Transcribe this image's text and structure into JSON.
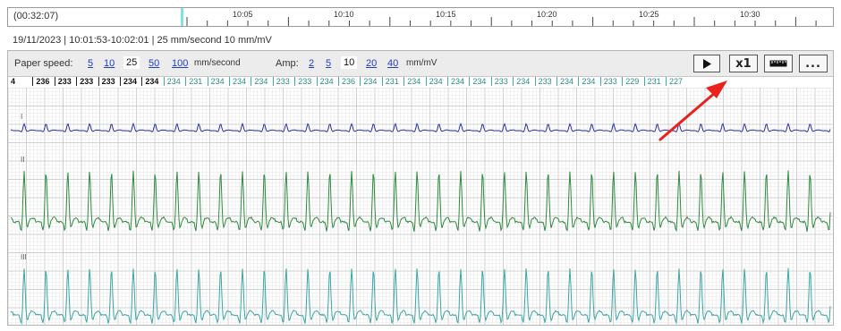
{
  "timeline": {
    "elapsed": "(00:32:07)",
    "labels": [
      "10:05",
      "10:10",
      "10:15",
      "10:20",
      "10:25",
      "10:30"
    ]
  },
  "session_info": "19/11/2023 | 10:01:53-10:02:01 | 25 mm/second 10 mm/mV",
  "toolbar": {
    "paper_speed_label": "Paper speed:",
    "paper_speed_options": [
      "5",
      "10",
      "25",
      "50",
      "100"
    ],
    "paper_speed_selected": "25",
    "paper_speed_unit": "mm/second",
    "amp_label": "Amp:",
    "amp_options": [
      "2",
      "5",
      "10",
      "20",
      "40"
    ],
    "amp_selected": "10",
    "amp_unit": "mm/mV",
    "speed_button_label": "x1",
    "more_button_label": "...",
    "play_icon": "play-icon",
    "ruler_icon": "ruler-icon"
  },
  "beats": [
    "4",
    "236",
    "233",
    "233",
    "233",
    "234",
    "234",
    "234",
    "231",
    "234",
    "234",
    "234",
    "233",
    "233",
    "234",
    "236",
    "234",
    "231",
    "234",
    "234",
    "234",
    "234",
    "233",
    "234",
    "233",
    "234",
    "234",
    "233",
    "229",
    "231",
    "227"
  ],
  "beats_highlighted_count": 7,
  "leads": [
    "I",
    "II",
    "III"
  ],
  "colors": {
    "lead_I": "#2b2fa5",
    "lead_II": "#2e8b3e",
    "lead_III": "#3aa6a6",
    "beat_highlight": "#111111",
    "beat_normal": "#2a8a8a",
    "grid_minor": "#e6e6e6",
    "grid_major": "#c4c4c4",
    "annotation": "#e8231c",
    "cursor": "#7fe3e6"
  }
}
